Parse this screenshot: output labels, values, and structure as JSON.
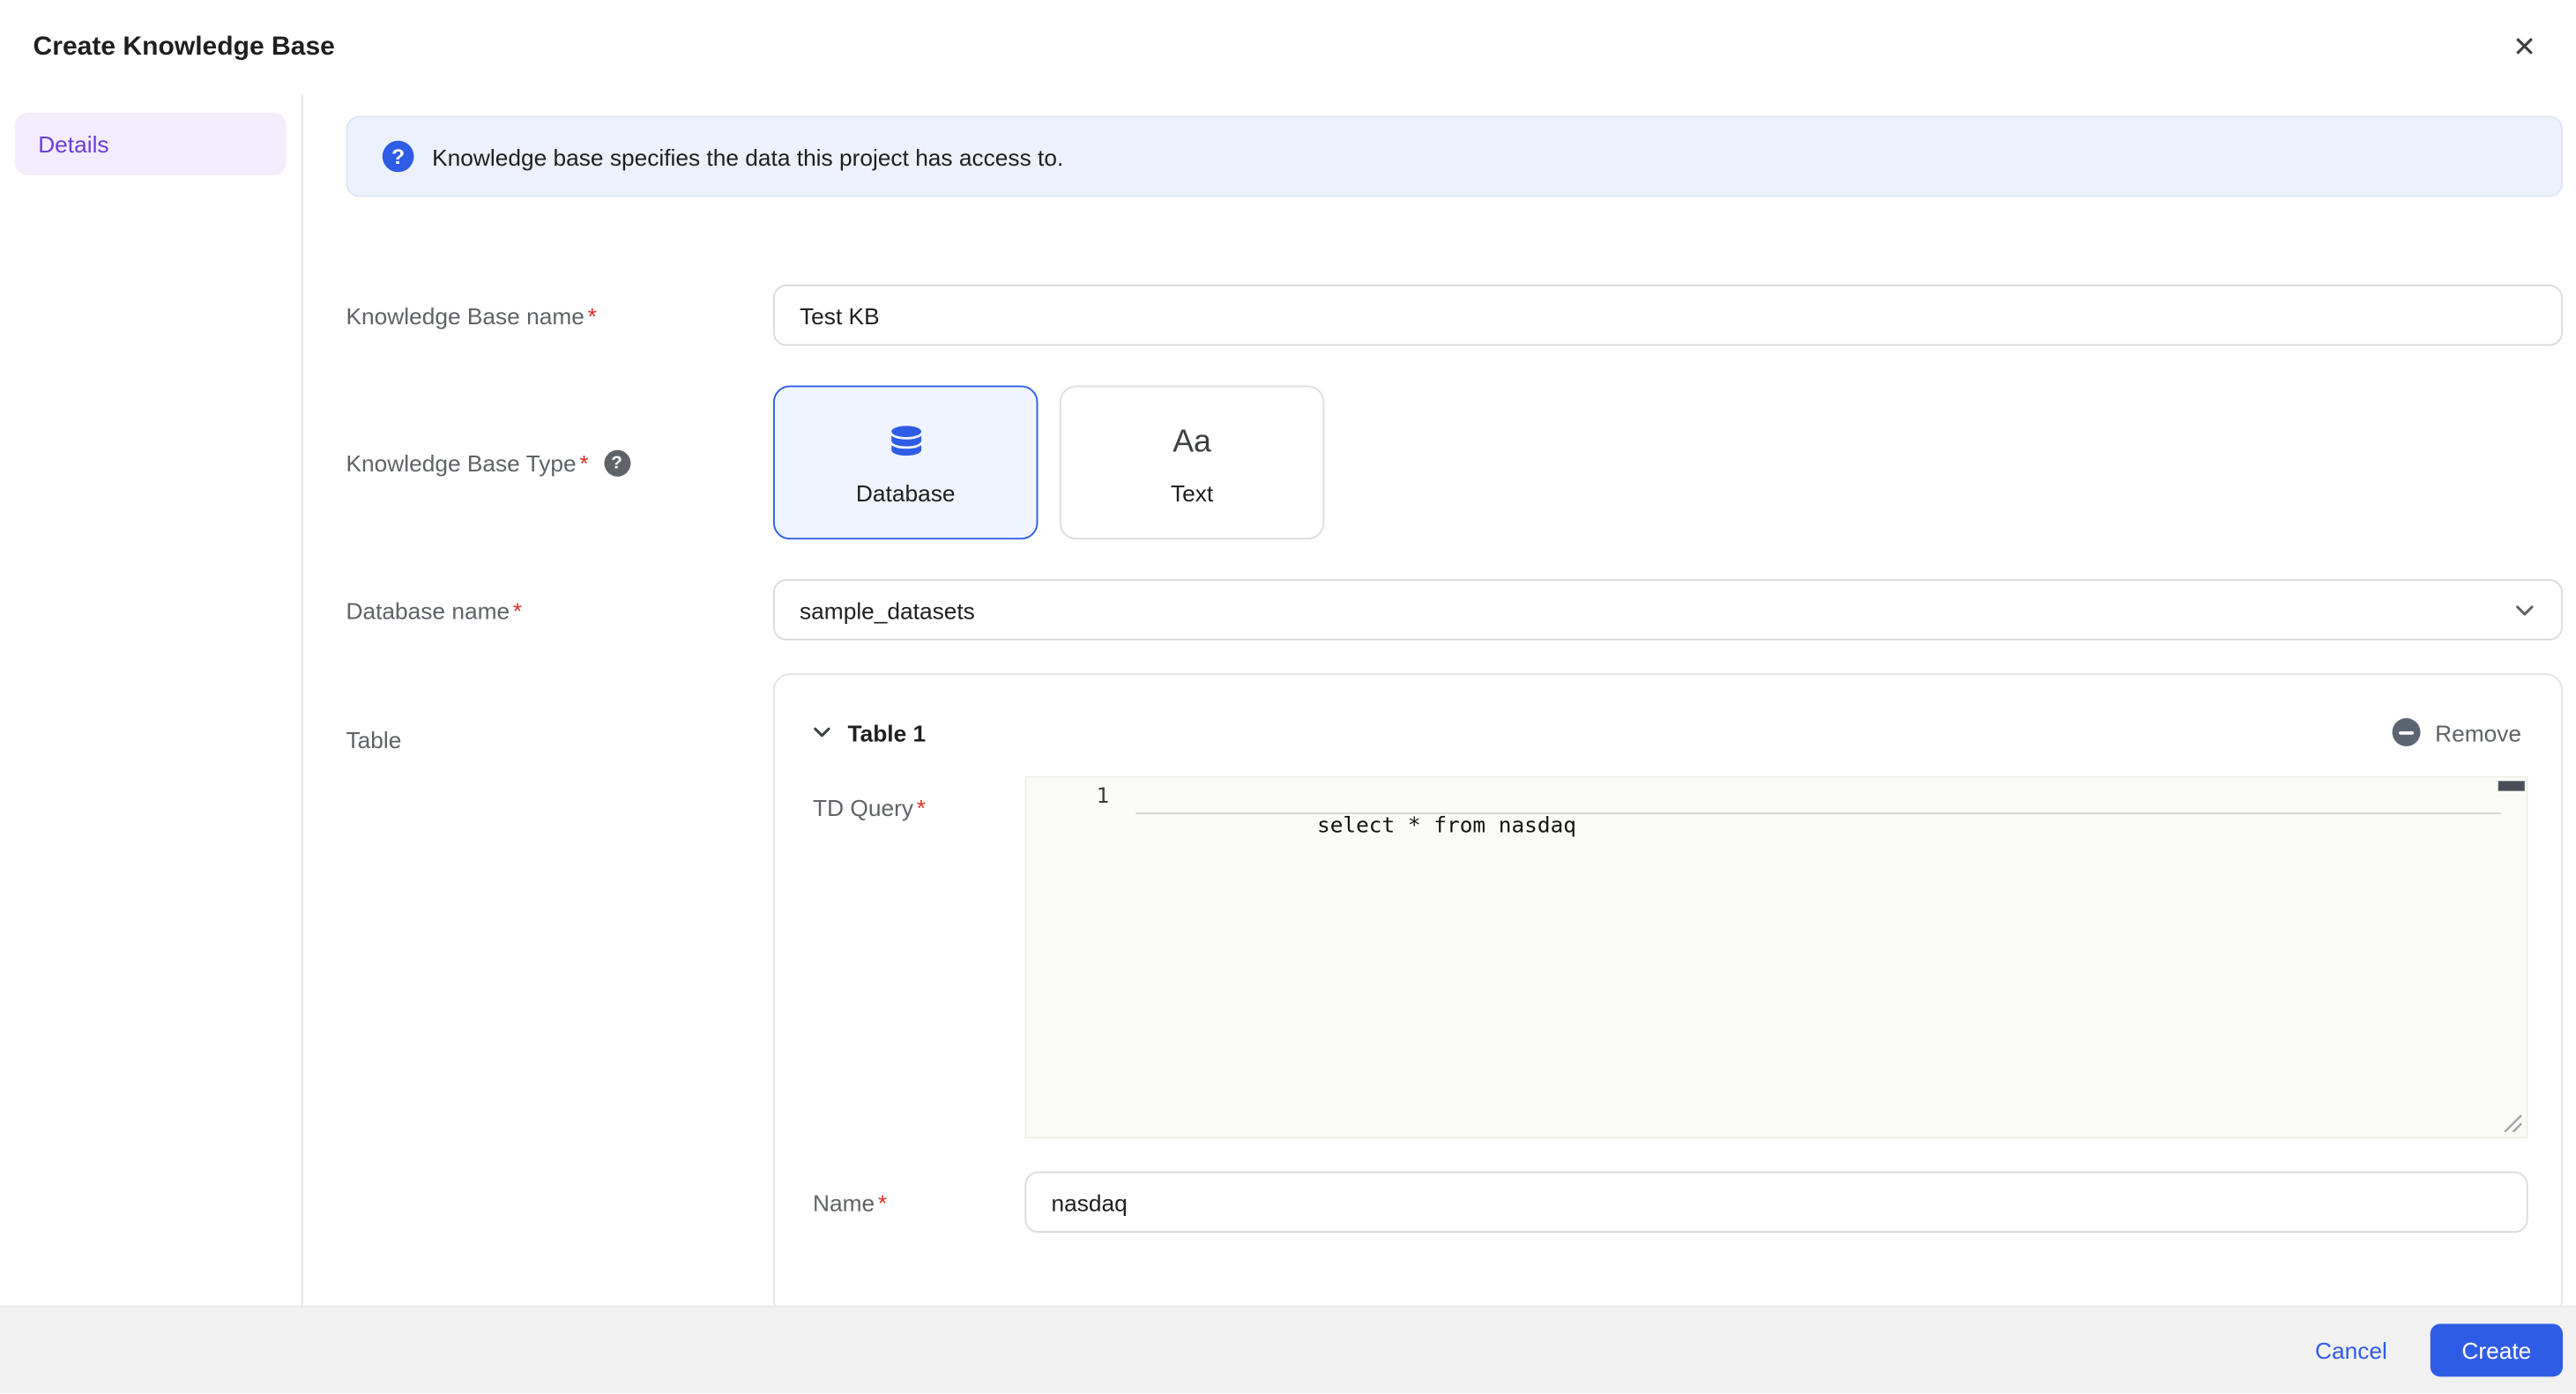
{
  "icons": {
    "close": "✕",
    "help": "?",
    "text_type": "Aa",
    "required": "*"
  },
  "header": {
    "title": "Create Knowledge Base"
  },
  "sidebar": {
    "items": [
      {
        "label": "Details",
        "active": true
      }
    ]
  },
  "banner": {
    "text": "Knowledge base specifies the data this project has access to."
  },
  "form": {
    "kb_name": {
      "label": "Knowledge Base name",
      "required": true,
      "value": "Test KB"
    },
    "kb_type": {
      "label": "Knowledge Base Type",
      "required": true,
      "selected": "Database",
      "options": [
        {
          "label": "Database",
          "icon": "database-icon"
        },
        {
          "label": "Text",
          "icon": "text-icon"
        }
      ]
    },
    "database_name": {
      "label": "Database name",
      "required": true,
      "value": "sample_datasets"
    },
    "table": {
      "label": "Table",
      "title": "Table 1",
      "remove_label": "Remove",
      "td_query": {
        "label": "TD Query",
        "required": true,
        "line_number": "1",
        "code": "select * from nasdaq"
      },
      "name": {
        "label": "Name",
        "required": true,
        "value": "nasdaq"
      }
    }
  },
  "footer": {
    "cancel_label": "Cancel",
    "create_label": "Create"
  },
  "colors": {
    "accent_blue": "#2e5ce5",
    "sidebar_active_text": "#6a3fd8",
    "sidebar_active_bg": "#f2ecfd",
    "banner_bg": "#edf1fb",
    "label_gray": "#5f6368",
    "required_red": "#d93025",
    "footer_bg": "#f1f1f2",
    "editor_bg": "#fafaf7"
  }
}
